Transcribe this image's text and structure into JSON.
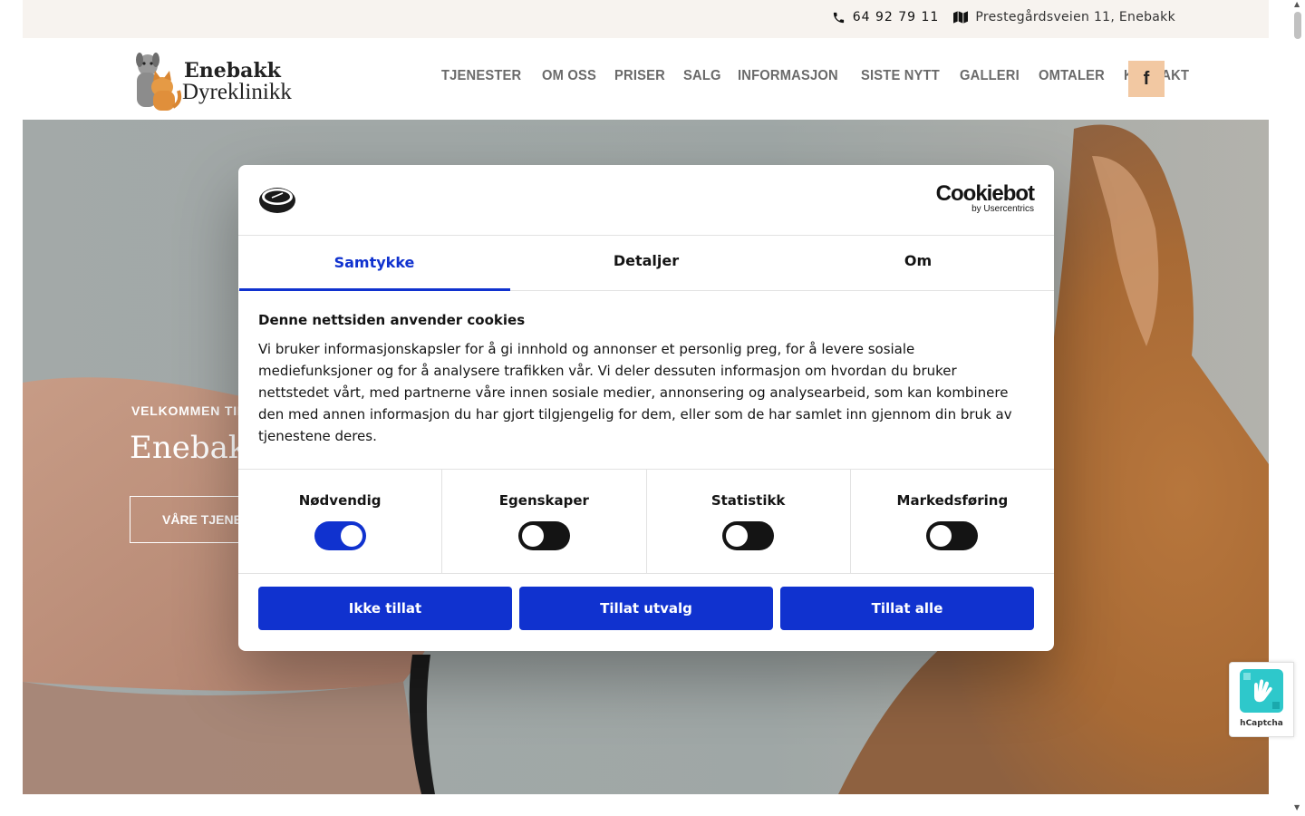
{
  "topbar": {
    "phone": "64 92 79 11",
    "address": "Prestegårdsveien 11, Enebakk"
  },
  "header": {
    "logo_line1": "Enebakk",
    "logo_line2": "Dyreklinikk",
    "nav": [
      "TJENESTER",
      "OM OSS",
      "PRISER",
      "SALG",
      "INFORMASJON",
      "SISTE NYTT",
      "GALLERI",
      "OMTALER",
      "KONTAKT"
    ],
    "facebook_icon": "facebook-icon"
  },
  "hero": {
    "welcome": "VELKOMMEN TIL",
    "title": "Enebakk",
    "button": "VÅRE TJENES"
  },
  "cookie_dialog": {
    "brand": "Cookiebot",
    "brand_sub": "by Usercentrics",
    "tabs": [
      "Samtykke",
      "Detaljer",
      "Om"
    ],
    "heading": "Denne nettsiden anvender cookies",
    "body": "Vi bruker informasjonskapsler for å gi innhold og annonser et personlig preg, for å levere sosiale mediefunksjoner og for å analysere trafikken vår. Vi deler dessuten informasjon om hvordan du bruker nettstedet vårt, med partnerne våre innen sosiale medier, annonsering og analysearbeid, som kan kombinere den med annen informasjon du har gjort tilgjengelig for dem, eller som de har samlet inn gjennom din bruk av tjenestene deres.",
    "categories": [
      {
        "label": "Nødvendig",
        "enabled": true
      },
      {
        "label": "Egenskaper",
        "enabled": false
      },
      {
        "label": "Statistikk",
        "enabled": false
      },
      {
        "label": "Markedsføring",
        "enabled": false
      }
    ],
    "buttons": [
      "Ikke tillat",
      "Tillat utvalg",
      "Tillat alle"
    ],
    "accent_color": "#1032cf"
  },
  "hcaptcha": {
    "label": "hCaptcha"
  }
}
